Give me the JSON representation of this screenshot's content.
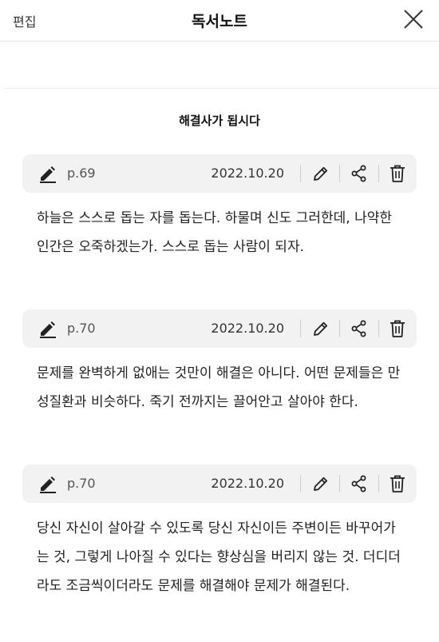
{
  "header": {
    "edit_label": "편집",
    "title": "독서노트",
    "close_icon": "close-icon"
  },
  "book": {
    "title": "해결사가 됩시다"
  },
  "notes": [
    {
      "page": "p.69",
      "date": "2022.10.20",
      "text": "하늘은 스스로 돕는 자를 돕는다. 하물며 신도 그러한데, 나약한 인간은 오죽하겠는가. 스스로 돕는 사람이 되자."
    },
    {
      "page": "p.70",
      "date": "2022.10.20",
      "text": "문제를 완벽하게 없애는 것만이 해결은 아니다. 어떤 문제들은 만성질환과 비슷하다. 죽기 전까지는 끌어안고 살아야 한다."
    },
    {
      "page": "p.70",
      "date": "2022.10.20",
      "text": "당신 자신이 살아갈 수 있도록 당신 자신이든 주변이든 바꾸어가는 것, 그렇게 나아질 수 있다는 향상심을 버리지 않는 것. 더디더라도 조금씩이더라도 문제를 해결해야 문제가 해결된다."
    }
  ],
  "icons": {
    "note_marker": "pencil-icon",
    "edit": "edit-icon",
    "share": "share-icon",
    "delete": "trash-icon"
  },
  "colors": {
    "bar_background": "#f2f2f2",
    "text": "#222222",
    "separator": "#cfcfcf"
  }
}
